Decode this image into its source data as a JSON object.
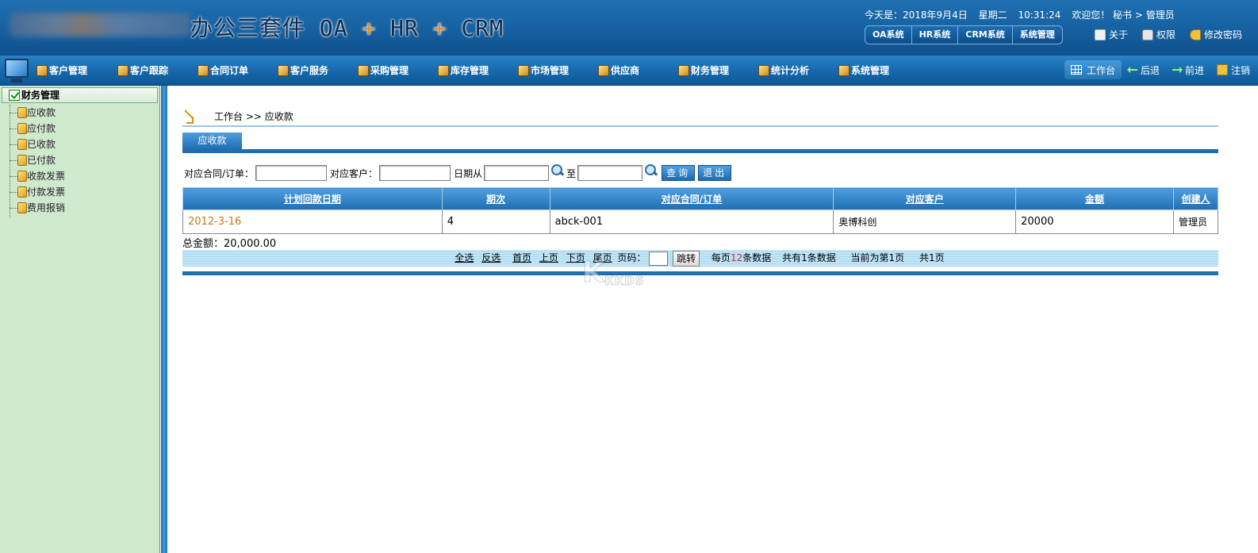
{
  "header": {
    "title_main": "办公三套件 OA",
    "title_plus": "+",
    "title_hr": "HR",
    "title_crm": "CRM",
    "date_text": "今天是：2018年9月4日",
    "weekday": "星期二",
    "time": "10:31:24",
    "welcome": "欢迎您！ 秘书 > 管理员",
    "systems": [
      "OA系统",
      "HR系统",
      "CRM系统",
      "系统管理"
    ],
    "links": [
      {
        "label": "关于",
        "icon": "document-icon"
      },
      {
        "label": "权限",
        "icon": "lock-icon"
      },
      {
        "label": "修改密码",
        "icon": "key-icon"
      }
    ]
  },
  "menu": {
    "items": [
      {
        "label": "客户管理",
        "icon": "customer-management-icon"
      },
      {
        "label": "客户跟踪",
        "icon": "customer-tracking-icon"
      },
      {
        "label": "合同订单",
        "icon": "contract-order-icon"
      },
      {
        "label": "客户服务",
        "icon": "customer-service-icon"
      },
      {
        "label": "采购管理",
        "icon": "purchase-icon"
      },
      {
        "label": "库存管理",
        "icon": "inventory-icon"
      },
      {
        "label": "市场管理",
        "icon": "market-icon"
      },
      {
        "label": "供应商",
        "icon": "supplier-icon"
      },
      {
        "label": "财务管理",
        "icon": "finance-icon"
      },
      {
        "label": "统计分析",
        "icon": "statistics-icon"
      },
      {
        "label": "系统管理",
        "icon": "system-management-icon"
      }
    ],
    "tools": [
      "工作台",
      "后退",
      "前进",
      "注销"
    ]
  },
  "sidebar": {
    "title": "财务管理",
    "items": [
      "应收款",
      "应付款",
      "已收款",
      "已付款",
      "收款发票",
      "付款发票",
      "费用报销"
    ]
  },
  "main": {
    "breadcrumb": "工作台 >> 应收款",
    "tab": "应收款",
    "search": {
      "contract_label": "对应合同/订单：",
      "customer_label": "对应客户：",
      "date_from_label": "日期从",
      "date_to_label": "至",
      "query_button": "查询",
      "exit_button": "退出",
      "contract_value": "",
      "customer_value": "",
      "date_from_value": "",
      "date_to_value": ""
    },
    "table": {
      "columns": [
        "计划回款日期",
        "期次",
        "对应合同/订单",
        "对应客户",
        "金额",
        "创建人"
      ],
      "rows": [
        [
          "2012-3-16",
          "4",
          "abck-001",
          "奥博科创",
          "20000",
          "管理员"
        ]
      ]
    },
    "total": "总金额：20,000.00",
    "pager": {
      "select_all": "全选",
      "invert": "反选",
      "first": "首页",
      "prev": "上页",
      "next": "下页",
      "last": "尾页",
      "page_label": "页码：",
      "page_value": "",
      "jump": "跳转",
      "per_page_prefix": "每页",
      "per_page_count": "12",
      "per_page_suffix": "条数据",
      "total_records": "共有1条数据",
      "current_page": "当前为第1页",
      "total_pages": "共1页"
    }
  },
  "watermark": {
    "main": "K",
    "sub": "KKDS"
  },
  "colors": {
    "header_blue": "#1660a0",
    "sidebar_green": "#cfe9cf",
    "accent_orange": "#c8781a",
    "pager_count_red": "#e02020"
  }
}
